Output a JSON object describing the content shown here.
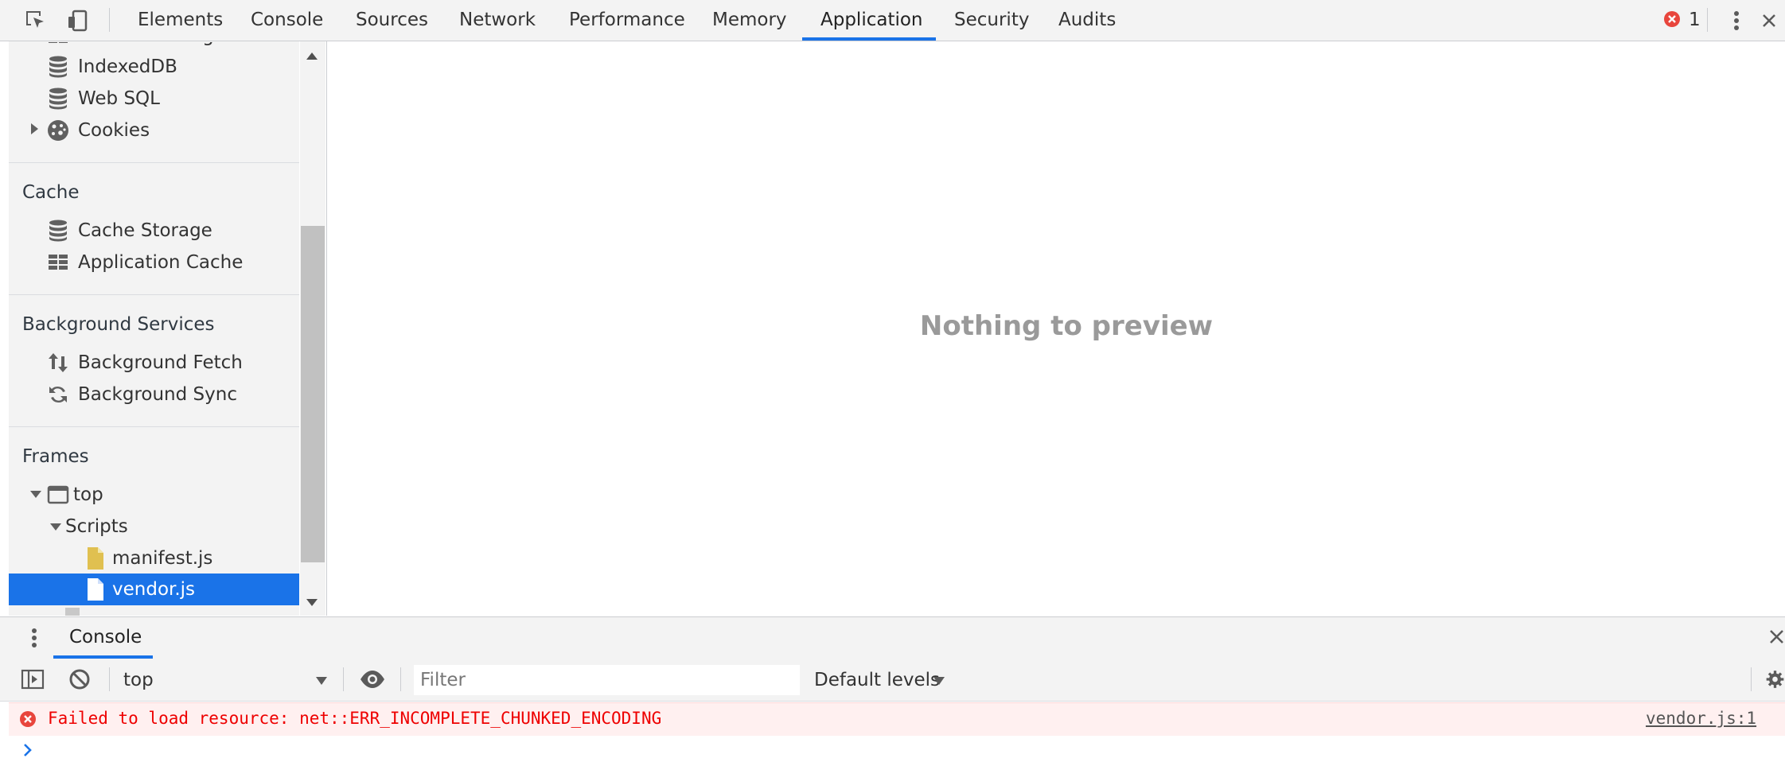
{
  "toolbar": {
    "tabs": [
      {
        "label": "Elements"
      },
      {
        "label": "Console"
      },
      {
        "label": "Sources"
      },
      {
        "label": "Network"
      },
      {
        "label": "Performance"
      },
      {
        "label": "Memory"
      },
      {
        "label": "Application",
        "active": true
      },
      {
        "label": "Security"
      },
      {
        "label": "Audits"
      }
    ],
    "error_count": "1",
    "accent_color": "#1a73e8"
  },
  "sidebar": {
    "storage_items": [
      {
        "label": "Session Storage",
        "icon": "table-icon"
      },
      {
        "label": "IndexedDB",
        "icon": "database-icon"
      },
      {
        "label": "Web SQL",
        "icon": "database-icon"
      },
      {
        "label": "Cookies",
        "icon": "cookie-icon"
      }
    ],
    "cache_section": "Cache",
    "cache_items": [
      {
        "label": "Cache Storage",
        "icon": "database-icon"
      },
      {
        "label": "Application Cache",
        "icon": "table-icon"
      }
    ],
    "bg_section": "Background Services",
    "bg_items": [
      {
        "label": "Background Fetch",
        "icon": "updown-arrows-icon"
      },
      {
        "label": "Background Sync",
        "icon": "sync-icon"
      }
    ],
    "frames_section": "Frames",
    "frame_top": "top",
    "scripts_folder": "Scripts",
    "scripts": [
      {
        "label": "manifest.js"
      },
      {
        "label": "vendor.js",
        "selected": true
      }
    ]
  },
  "main": {
    "empty_message": "Nothing to preview"
  },
  "drawer": {
    "tab_label": "Console",
    "context": "top",
    "filter_placeholder": "Filter",
    "levels_label": "Default levels",
    "error_message": "Failed to load resource: net::ERR_INCOMPLETE_CHUNKED_ENCODING",
    "error_source": "vendor.js:1",
    "error_color": "#e00000"
  }
}
